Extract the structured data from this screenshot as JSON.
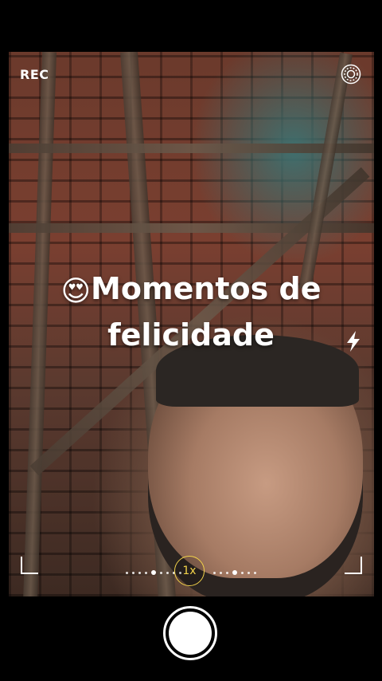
{
  "recording": {
    "label": "REC"
  },
  "caption": {
    "emoji": "😍",
    "text": "Momentos de felicidade"
  },
  "zoom": {
    "level_label": "1x"
  },
  "icons": {
    "settings": "settings-icon",
    "flash": "flash-icon",
    "shutter": "shutter-button"
  },
  "colors": {
    "zoom_accent": "#f2d24a",
    "background": "#000000",
    "text": "#ffffff"
  }
}
